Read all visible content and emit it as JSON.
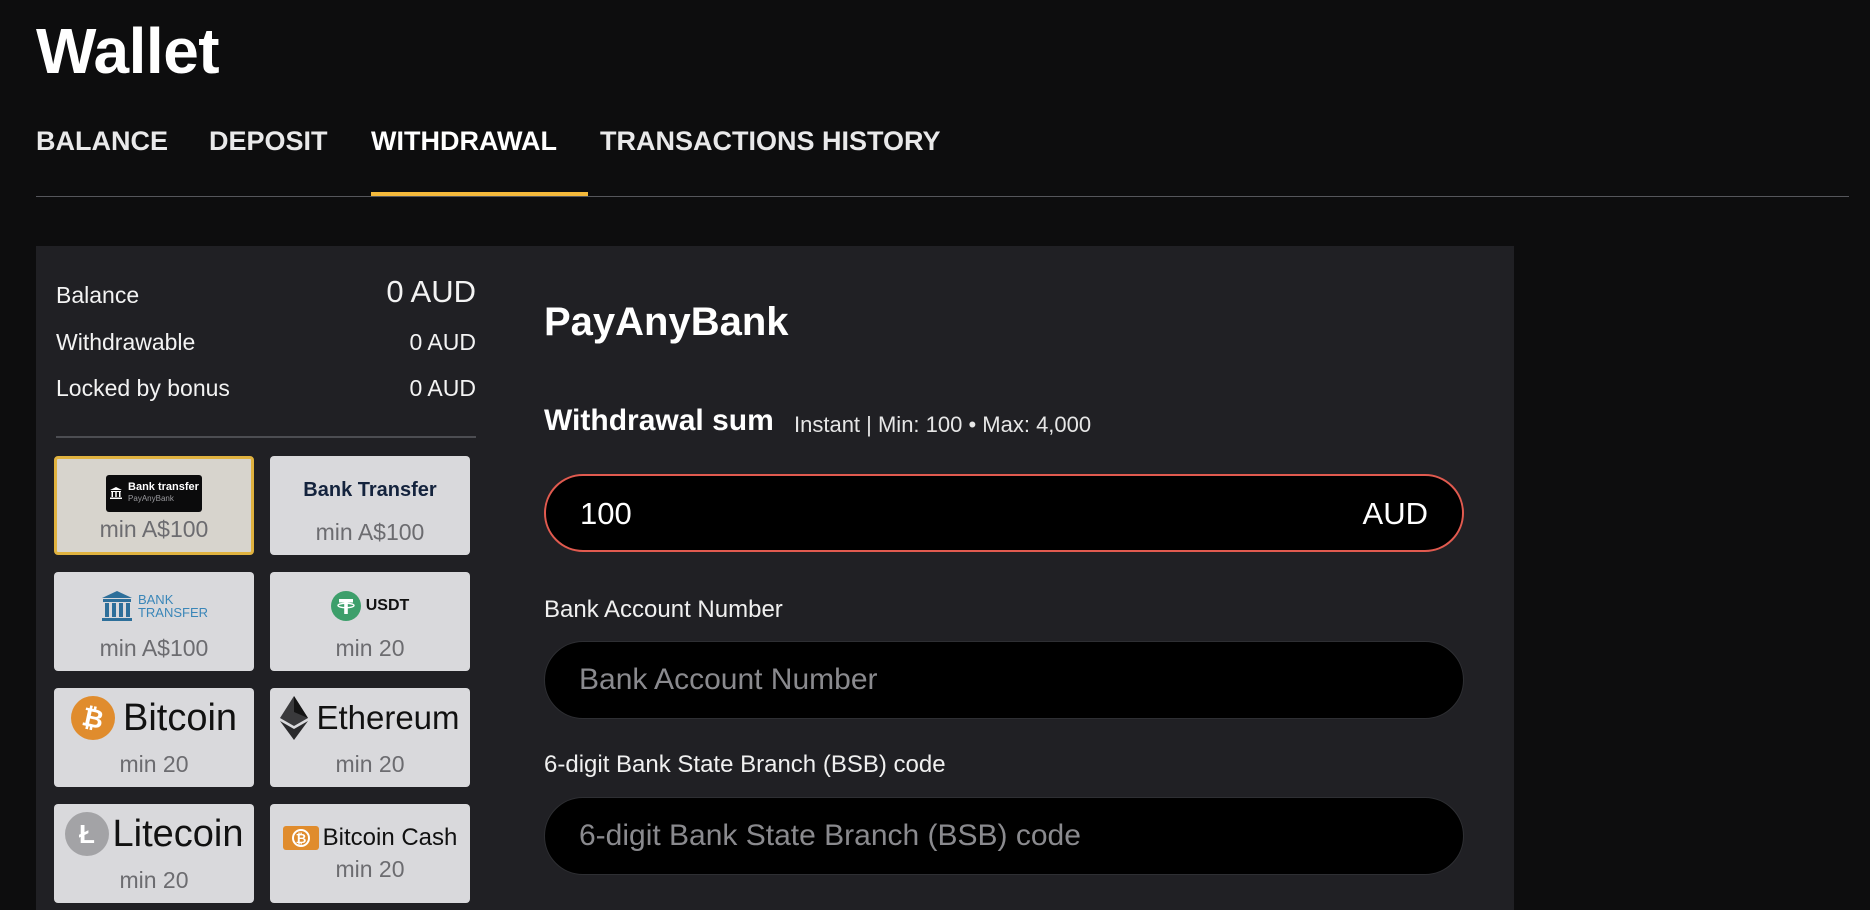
{
  "page": {
    "title": "Wallet"
  },
  "tabs": [
    {
      "label": "BALANCE"
    },
    {
      "label": "DEPOSIT"
    },
    {
      "label": "WITHDRAWAL",
      "active": true
    },
    {
      "label": "TRANSACTIONS HISTORY"
    }
  ],
  "summary": {
    "balance_label": "Balance",
    "balance_value": "0 AUD",
    "withdrawable_label": "Withdrawable",
    "withdrawable_value": "0 AUD",
    "locked_label": "Locked by bonus",
    "locked_value": "0 AUD"
  },
  "methods": [
    {
      "name": "PayAnyBank Bank transfer",
      "logo_text": "Bank transfer",
      "logo_subtext": "PayAnyBank",
      "min": "min A$100",
      "selected": true
    },
    {
      "name": "Bank Transfer",
      "logo_text": "Bank Transfer",
      "min": "min A$100"
    },
    {
      "name": "Bank Transfer",
      "logo_text": "BANK",
      "logo_subtext": "TRANSFER",
      "min": "min A$100"
    },
    {
      "name": "USDT",
      "logo_text": "USDT",
      "min": "min 20"
    },
    {
      "name": "Bitcoin",
      "logo_text": "Bitcoin",
      "min": "min 20"
    },
    {
      "name": "Ethereum",
      "logo_text": "Ethereum",
      "min": "min 20"
    },
    {
      "name": "Litecoin",
      "logo_text": "Litecoin",
      "min": "min 20"
    },
    {
      "name": "Bitcoin Cash",
      "logo_text": "Bitcoin Cash",
      "min": "min 20"
    }
  ],
  "form": {
    "method_title": "PayAnyBank",
    "sum_label": "Withdrawal sum",
    "sum_limits": "Instant | Min: 100 • Max: 4,000",
    "amount_value": "100",
    "currency": "AUD",
    "account_label": "Bank Account Number",
    "account_placeholder": "Bank Account Number",
    "bsb_label": "6-digit Bank State Branch (BSB) code",
    "bsb_placeholder": "6-digit Bank State Branch (BSB) code"
  },
  "colors": {
    "background": "#0d0d0e",
    "panel": "#202024",
    "accent": "#f4b93b",
    "amount_border": "#e15a4f",
    "selected_border": "#e0b23f"
  }
}
